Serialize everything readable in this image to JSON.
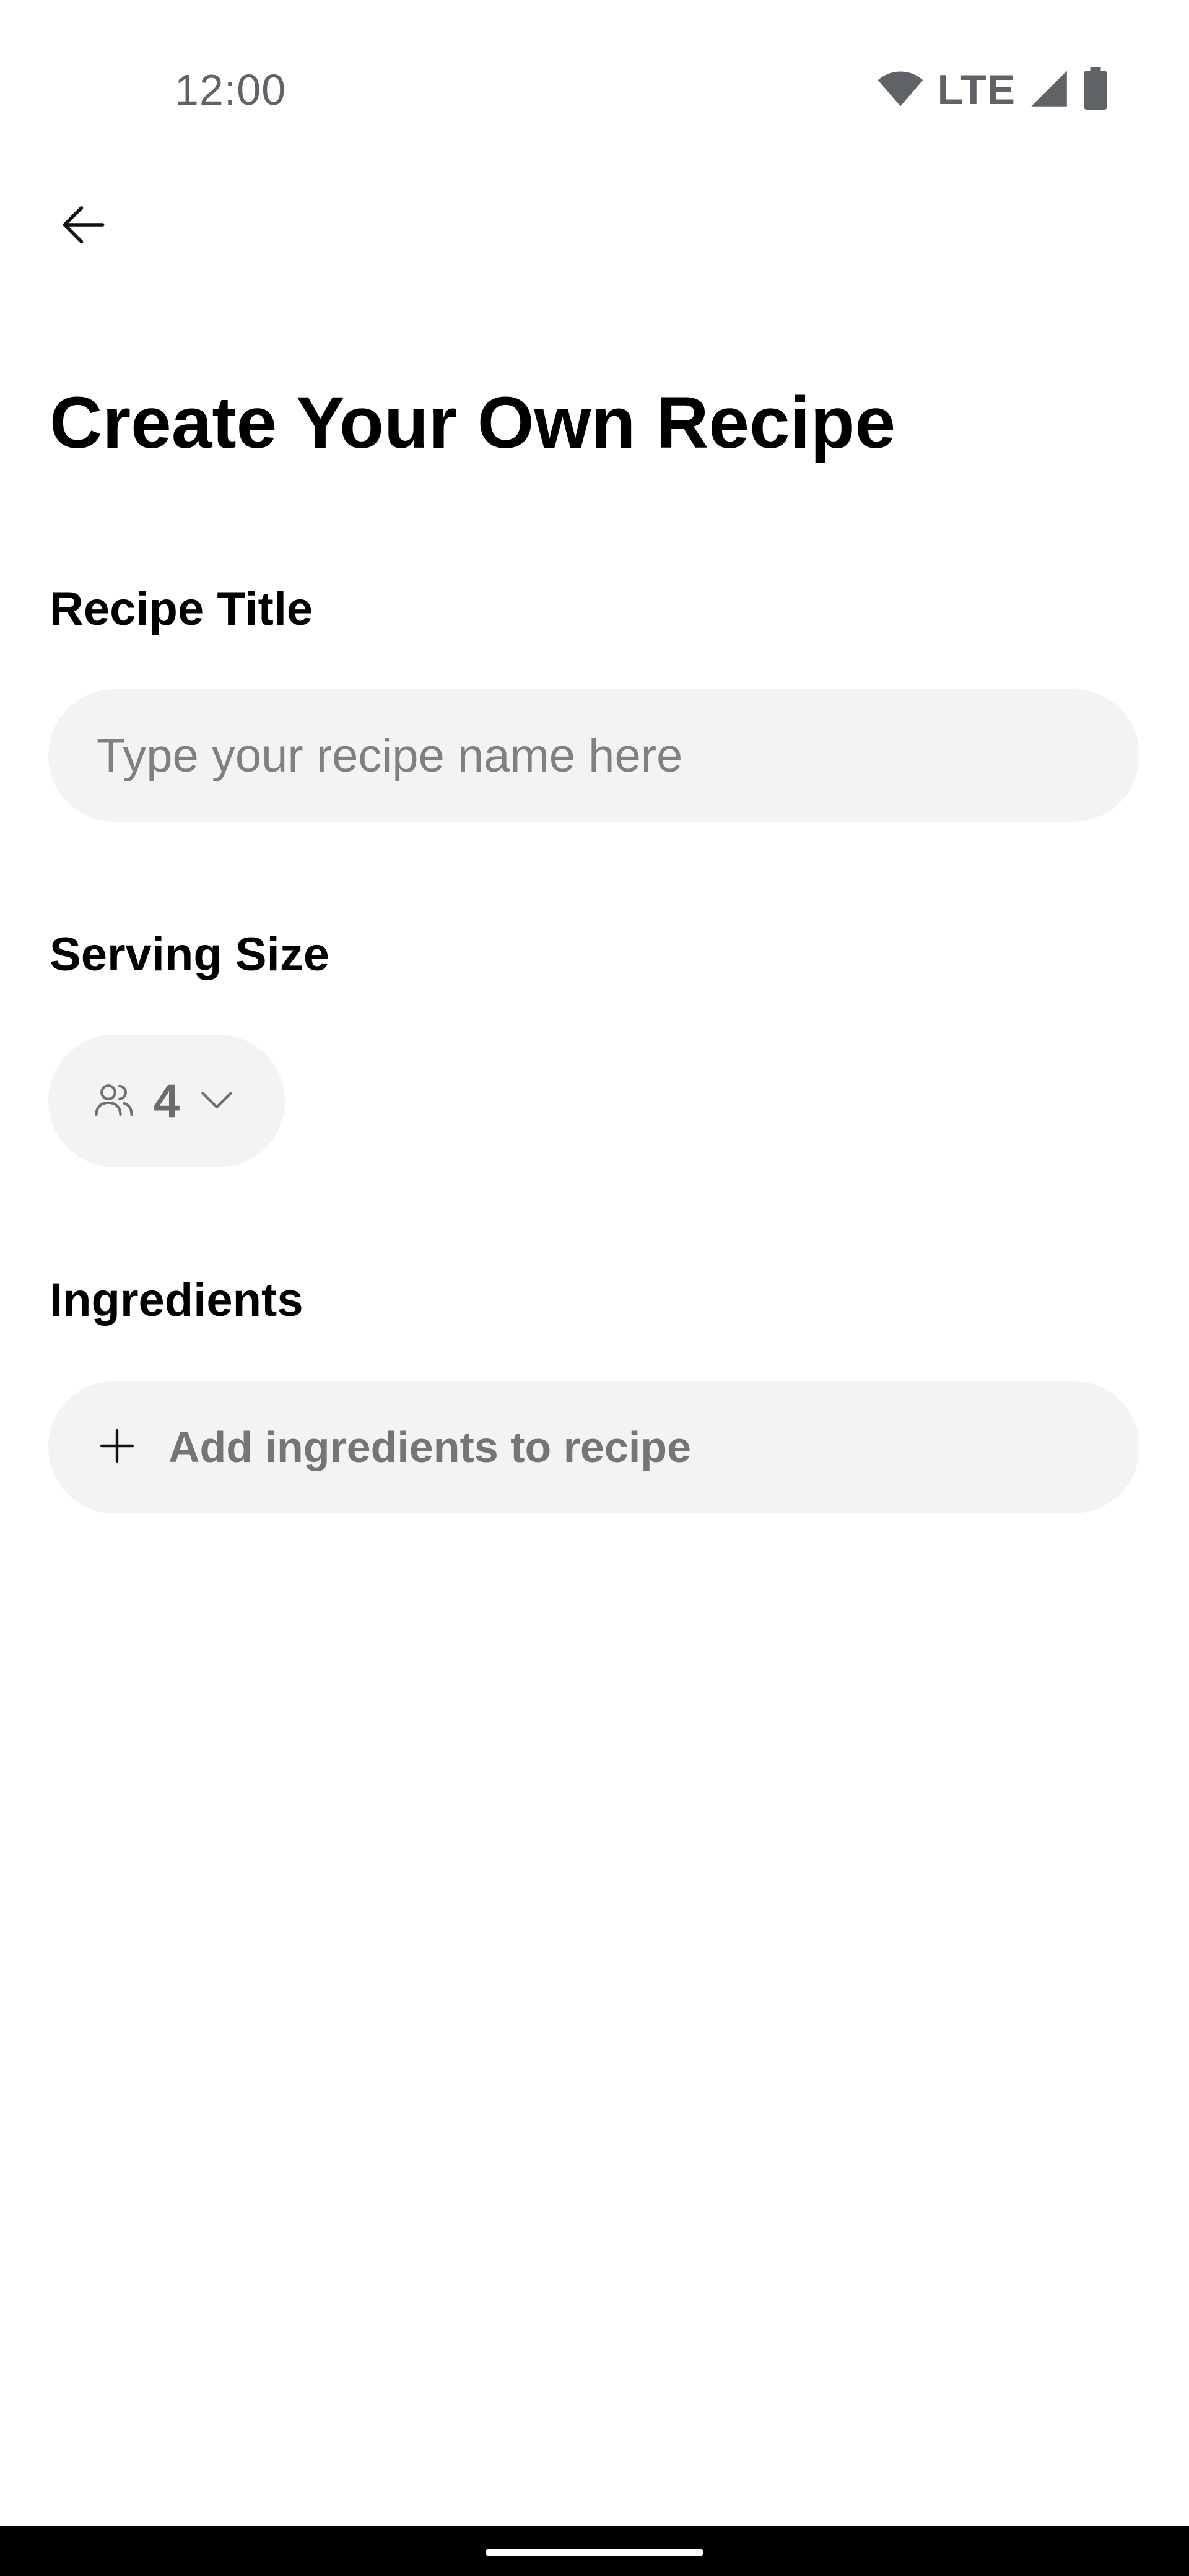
{
  "status_bar": {
    "time": "12:00",
    "network": "LTE",
    "icons": [
      "wifi-icon",
      "cell-signal-icon",
      "battery-icon"
    ]
  },
  "header": {
    "back_icon": "arrow-left-icon",
    "title": "Create Your Own Recipe"
  },
  "recipe_title": {
    "label": "Recipe Title",
    "placeholder": "Type your recipe name here",
    "value": ""
  },
  "serving_size": {
    "label": "Serving Size",
    "icon": "people-icon",
    "value": "4",
    "dropdown_icon": "chevron-down-icon"
  },
  "ingredients": {
    "label": "Ingredients",
    "add_icon": "plus-icon",
    "add_label": "Add ingredients to recipe"
  },
  "colors": {
    "field_background": "#f3f3f3",
    "placeholder_text": "#808080",
    "muted_text": "#757575",
    "status_text": "#5f6368",
    "nav_bar": "#000000"
  }
}
